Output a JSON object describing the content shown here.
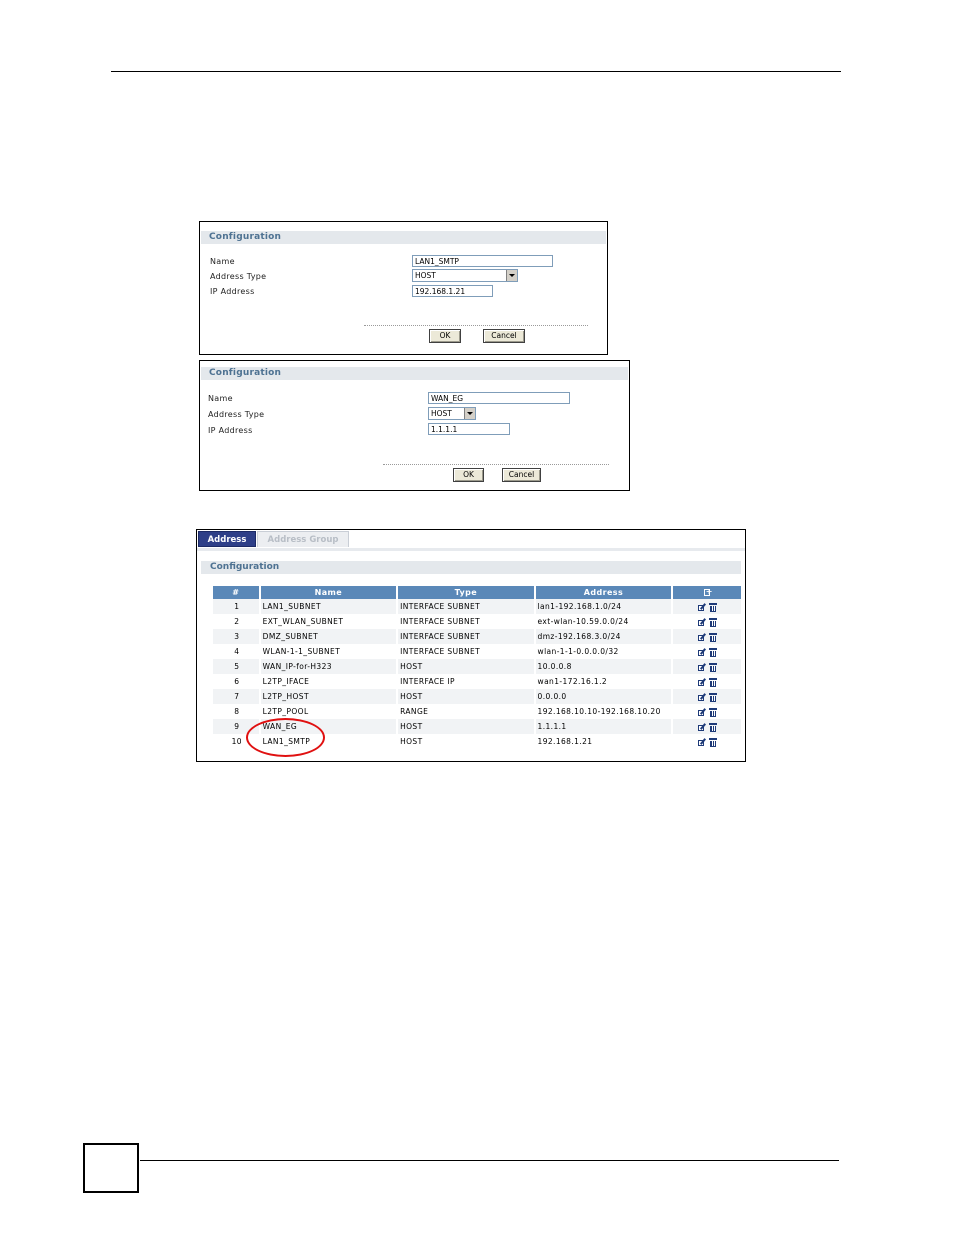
{
  "panel1": {
    "title": "Configuration",
    "name_label": "Name",
    "name_value": "LAN1_SMTP",
    "type_label": "Address Type",
    "type_value": "HOST",
    "ip_label": "IP Address",
    "ip_value": "192.168.1.21",
    "ok": "OK",
    "cancel": "Cancel"
  },
  "panel2": {
    "title": "Configuration",
    "name_label": "Name",
    "name_value": "WAN_EG",
    "type_label": "Address Type",
    "type_value": "HOST",
    "ip_label": "IP Address",
    "ip_value": "1.1.1.1",
    "ok": "OK",
    "cancel": "Cancel"
  },
  "list": {
    "tabs": [
      "Address",
      "Address Group"
    ],
    "section_title": "Configuration",
    "columns": [
      "#",
      "Name",
      "Type",
      "Address"
    ],
    "icons": {
      "add": "add-icon",
      "edit": "edit-icon",
      "delete": "delete-icon"
    },
    "rows": [
      {
        "num": "1",
        "name": "LAN1_SUBNET",
        "type": "INTERFACE SUBNET",
        "address": "lan1-192.168.1.0/24"
      },
      {
        "num": "2",
        "name": "EXT_WLAN_SUBNET",
        "type": "INTERFACE SUBNET",
        "address": "ext-wlan-10.59.0.0/24"
      },
      {
        "num": "3",
        "name": "DMZ_SUBNET",
        "type": "INTERFACE SUBNET",
        "address": "dmz-192.168.3.0/24"
      },
      {
        "num": "4",
        "name": "WLAN-1-1_SUBNET",
        "type": "INTERFACE SUBNET",
        "address": "wlan-1-1-0.0.0.0/32"
      },
      {
        "num": "5",
        "name": "WAN_IP-for-H323",
        "type": "HOST",
        "address": "10.0.0.8"
      },
      {
        "num": "6",
        "name": "L2TP_IFACE",
        "type": "INTERFACE IP",
        "address": "wan1-172.16.1.2"
      },
      {
        "num": "7",
        "name": "L2TP_HOST",
        "type": "HOST",
        "address": "0.0.0.0"
      },
      {
        "num": "8",
        "name": "L2TP_POOL",
        "type": "RANGE",
        "address": "192.168.10.10-192.168.10.20"
      },
      {
        "num": "9",
        "name": "WAN_EG",
        "type": "HOST",
        "address": "1.1.1.1"
      },
      {
        "num": "10",
        "name": "LAN1_SMTP",
        "type": "HOST",
        "address": "192.168.1.21"
      }
    ]
  },
  "colors": {
    "header_bg": "#5a88b8",
    "tab_active": "#2e3f88",
    "highlight_circle": "#e01010",
    "section_text": "#4e7292"
  }
}
